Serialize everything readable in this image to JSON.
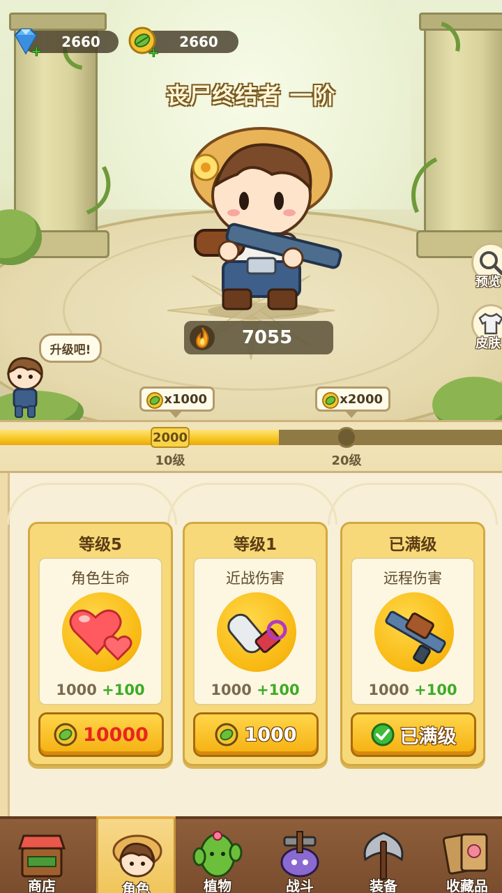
{
  "currency": {
    "gems": "2660",
    "leaves": "2660",
    "gem_icon": "diamond-icon",
    "leaf_icon": "leaf-coin-icon"
  },
  "character": {
    "title": "丧尸终结者 一阶",
    "power": "7055",
    "power_icon": "fire-icon"
  },
  "side_buttons": [
    {
      "label": "预览",
      "icon": "magnifier-icon"
    },
    {
      "label": "皮肤",
      "icon": "shirt-icon"
    }
  ],
  "speech_bubble": "升级吧!",
  "progress": {
    "fill_fraction": 0.555,
    "milestones": [
      {
        "badge": "2000",
        "level_label": "10级",
        "reward": "x1000",
        "reached": true
      },
      {
        "badge": "",
        "level_label": "20级",
        "reward": "x2000",
        "reached": false
      }
    ]
  },
  "cards": [
    {
      "title": "等级5",
      "stat": "角色生命",
      "base": "1000",
      "bonus": "+100",
      "button": "10000",
      "button_color": "#e8261d",
      "icon": "hearts-icon",
      "maxed": false
    },
    {
      "title": "等级1",
      "stat": "近战伤害",
      "base": "1000",
      "bonus": "+100",
      "button": "1000",
      "button_color": "#ffffff",
      "icon": "chainsaw-icon",
      "maxed": false
    },
    {
      "title": "已满级",
      "stat": "远程伤害",
      "base": "1000",
      "bonus": "+100",
      "button": "已满级",
      "button_color": "#ffffff",
      "icon": "rifle-icon",
      "maxed": true
    }
  ],
  "nav": [
    {
      "label": "商店",
      "icon": "shop-icon",
      "active": false
    },
    {
      "label": "角色",
      "icon": "hero-face-icon",
      "active": true
    },
    {
      "label": "植物",
      "icon": "cactus-icon",
      "active": false
    },
    {
      "label": "战斗",
      "icon": "zombie-axe-icon",
      "active": false
    },
    {
      "label": "装备",
      "icon": "battle-axe-icon",
      "active": false
    },
    {
      "label": "收藏品",
      "icon": "cards-icon",
      "active": false
    }
  ],
  "colors": {
    "accent_gold": "#f6c521",
    "bonus_green": "#3dab26",
    "cost_red": "#e8261d",
    "nav_brown": "#7a4d2e"
  }
}
